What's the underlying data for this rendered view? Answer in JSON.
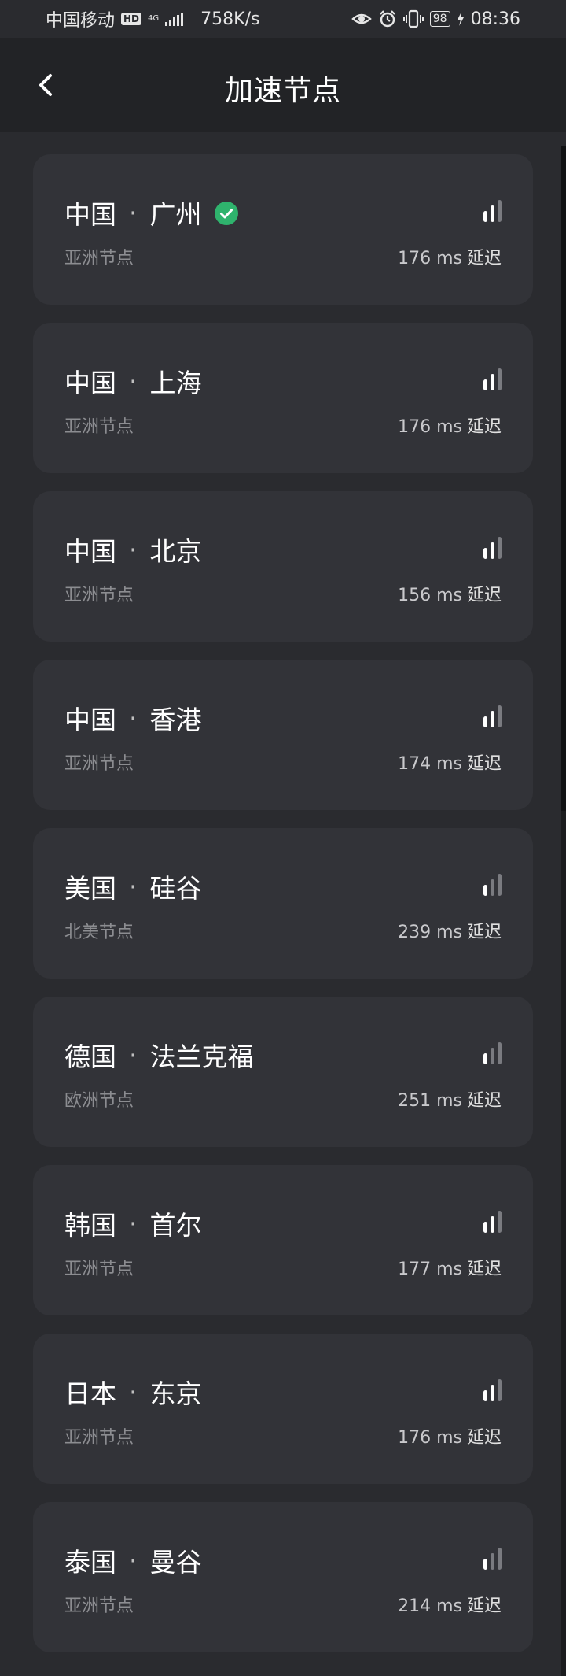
{
  "status_bar": {
    "carrier": "中国移动",
    "hd": "HD",
    "network": "4G",
    "speed": "758K/s",
    "battery": "98",
    "time": "08:36",
    "icons": [
      "eye-icon",
      "alarm-icon",
      "vibrate-icon",
      "charging-icon"
    ]
  },
  "header": {
    "title": "加速节点",
    "back_icon": "chevron-left-icon"
  },
  "colors": {
    "card_bg": "#323338",
    "page_bg": "#2a2b2f",
    "header_bg": "#222326",
    "check_green": "#2fb36d",
    "signal_on": "#ffffff",
    "signal_off": "#7a7b80"
  },
  "nodes": [
    {
      "country": "中国",
      "separator": "·",
      "city": "广州",
      "selected": true,
      "region": "亚洲节点",
      "latency": "176 ms",
      "latency_label": "延迟",
      "signal_level": 2
    },
    {
      "country": "中国",
      "separator": "·",
      "city": "上海",
      "selected": false,
      "region": "亚洲节点",
      "latency": "176 ms",
      "latency_label": "延迟",
      "signal_level": 2
    },
    {
      "country": "中国",
      "separator": "·",
      "city": "北京",
      "selected": false,
      "region": "亚洲节点",
      "latency": "156 ms",
      "latency_label": "延迟",
      "signal_level": 2
    },
    {
      "country": "中国",
      "separator": "·",
      "city": "香港",
      "selected": false,
      "region": "亚洲节点",
      "latency": "174 ms",
      "latency_label": "延迟",
      "signal_level": 2
    },
    {
      "country": "美国",
      "separator": "·",
      "city": "硅谷",
      "selected": false,
      "region": "北美节点",
      "latency": "239 ms",
      "latency_label": "延迟",
      "signal_level": 1
    },
    {
      "country": "德国",
      "separator": "·",
      "city": "法兰克福",
      "selected": false,
      "region": "欧洲节点",
      "latency": "251 ms",
      "latency_label": "延迟",
      "signal_level": 1
    },
    {
      "country": "韩国",
      "separator": "·",
      "city": "首尔",
      "selected": false,
      "region": "亚洲节点",
      "latency": "177 ms",
      "latency_label": "延迟",
      "signal_level": 2
    },
    {
      "country": "日本",
      "separator": "·",
      "city": "东京",
      "selected": false,
      "region": "亚洲节点",
      "latency": "176 ms",
      "latency_label": "延迟",
      "signal_level": 2
    },
    {
      "country": "泰国",
      "separator": "·",
      "city": "曼谷",
      "selected": false,
      "region": "亚洲节点",
      "latency": "214 ms",
      "latency_label": "延迟",
      "signal_level": 1
    }
  ]
}
